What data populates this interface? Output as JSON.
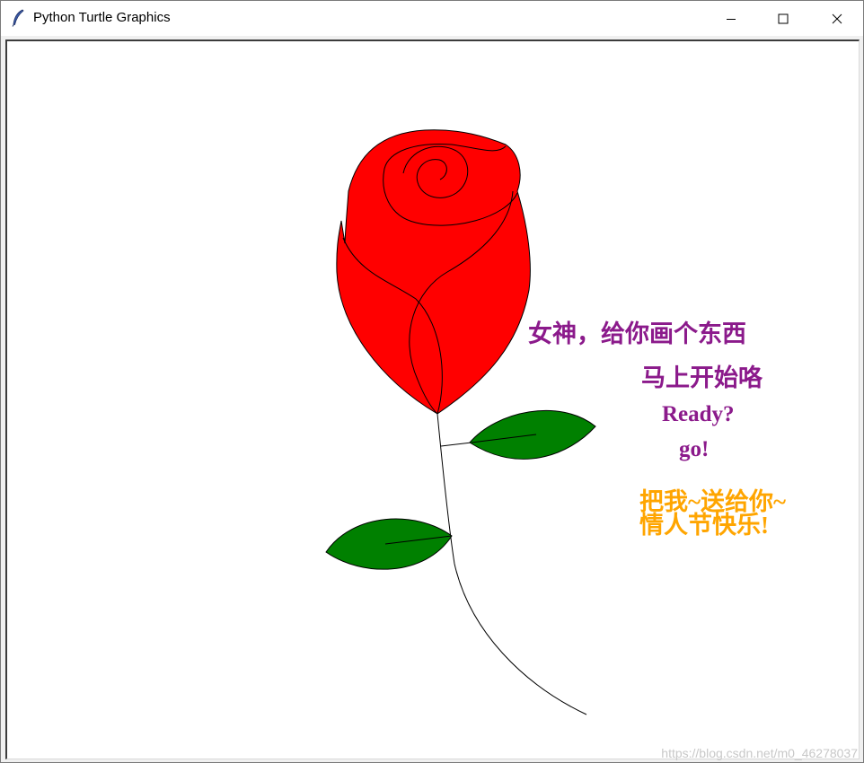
{
  "window": {
    "title": "Python Turtle Graphics",
    "icon": "feather-icon"
  },
  "controls": {
    "minimize_icon": "minimize-icon",
    "maximize_icon": "maximize-icon",
    "close_icon": "close-icon"
  },
  "canvas": {
    "lines": {
      "line1": "女神，给你画个东西",
      "line2": "马上开始咯",
      "line3": "Ready?",
      "line4": "go!",
      "line5": "把我~送给你~",
      "line6": "情人节快乐!"
    },
    "watermark": "https://blog.csdn.net/m0_46278037"
  },
  "colors": {
    "petal_fill": "#ff0000",
    "leaf_fill": "#008000",
    "text_purple": "#8b1a8b",
    "text_orange": "#ffa500",
    "outline": "#000000"
  }
}
